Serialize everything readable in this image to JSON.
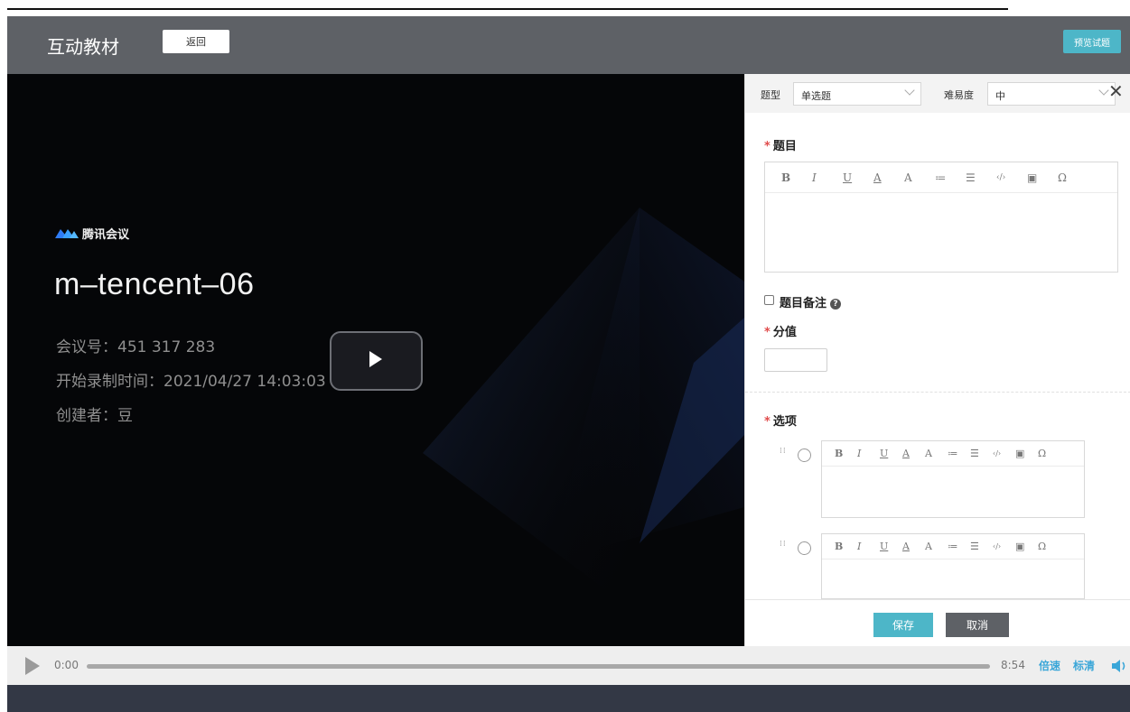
{
  "header": {
    "title": "互动教材",
    "back_label": "返回",
    "preview_label": "预览试题"
  },
  "video": {
    "brand": "腾讯会议",
    "meeting_name": "m–tencent–06",
    "meeting_no": "会议号：451 317 283",
    "record_time": "开始录制时间：2021/04/27 14:03:03",
    "creator": "创建者：豆"
  },
  "controls": {
    "current_time": "0:00",
    "duration": "8:54",
    "speed_label": "倍速",
    "quality_label": "标清",
    "progress": 0.0
  },
  "panel": {
    "type_label": "题型",
    "type_value": "单选题",
    "difficulty_label": "难易度",
    "difficulty_value": "中",
    "question_label": "题目",
    "note_label": "题目备注",
    "score_label": "分值",
    "options_label": "选项",
    "toolbar": [
      "B",
      "I",
      "U",
      "A",
      "A",
      "≔",
      "☰",
      "‹/›",
      "▣",
      "Ω"
    ],
    "save_label": "保存",
    "cancel_label": "取消"
  }
}
